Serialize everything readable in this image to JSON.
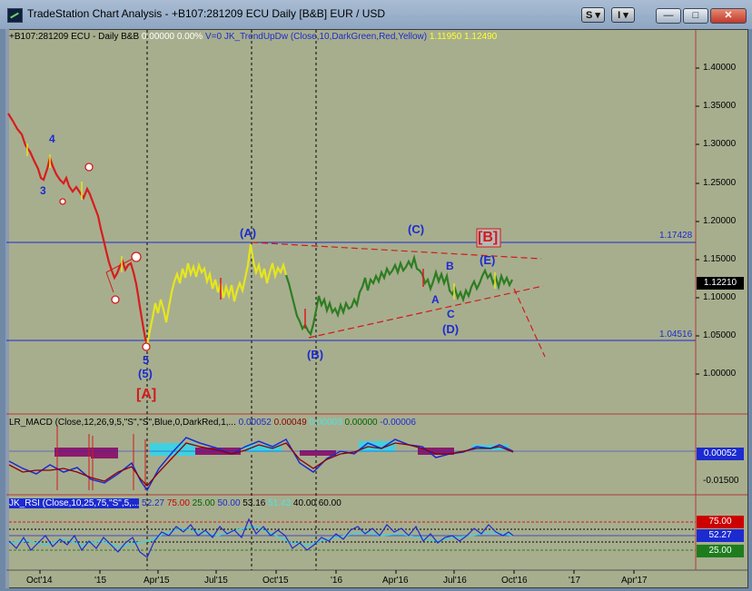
{
  "window": {
    "title": "TradeStation Chart Analysis - +B107:281209 ECU Daily [B&B] EUR / USD",
    "buttons": [
      "S",
      "I"
    ],
    "minimize": "—",
    "maximize": "□",
    "close": "✕"
  },
  "main_pane": {
    "label_parts": [
      {
        "text": "+B107:281209 ECU - Daily  B&B",
        "color": "#000000"
      },
      {
        "text": "  0.00000  0.00%",
        "color": "#ffffff"
      },
      {
        "text": "  V=0  JK_TrendUpDw (Close,10,DarkGreen,Red,Yellow)",
        "color": "#1c2bd0"
      },
      {
        "text": "  1.11950",
        "color": "#ffff33"
      },
      {
        "text": "  1.12490",
        "color": "#ffff33"
      }
    ],
    "price_axis": [
      "1.40000",
      "1.35000",
      "1.30000",
      "1.25000",
      "1.20000",
      "1.15000",
      "1.10000",
      "1.05000",
      "1.00000"
    ],
    "last_price": "1.12210",
    "level_high": "1.17428",
    "level_low": "1.04516",
    "wave_labels": {
      "w4": "4",
      "w3": "3",
      "wA_top": "(A)",
      "wC": "(C)",
      "wB_box": "[B]",
      "wE": "(E)",
      "wB_small": "B",
      "wA_small": "A",
      "wC_small": "C",
      "wD": "(D)",
      "wB_paren": "(B)",
      "w5": "5",
      "w5_paren": "(5)",
      "wA_box": "[A]"
    }
  },
  "macd_pane": {
    "label_parts": [
      {
        "text": "LR_MACD (Close,12,26,9,5,\"S\",\"S\",Blue,0,DarkRed,1,...",
        "color": "#000000"
      },
      {
        "text": "  0.00052",
        "color": "#1c2bd0"
      },
      {
        "text": "  0.00049",
        "color": "#8b0000"
      },
      {
        "text": "  0.00003",
        "color": "#4fe3e3"
      },
      {
        "text": "  0.00000",
        "color": "#006400"
      },
      {
        "text": "  -0.00006",
        "color": "#1c2bd0"
      }
    ],
    "axis": [
      "-0.01500"
    ],
    "last_value": "0.00052"
  },
  "rsi_pane": {
    "label_parts": [
      {
        "text": "JK_RSI (Close,10,25,75,\"S\",5,...",
        "color": "#000000"
      },
      {
        "text": "  52.27",
        "color": "#1c2bd0"
      },
      {
        "text": "  75.00",
        "color": "#cc0000"
      },
      {
        "text": "  25.00",
        "color": "#006400"
      },
      {
        "text": "  50.00",
        "color": "#1c2bd0"
      },
      {
        "text": "  53.16",
        "color": "#000000"
      },
      {
        "text": "  51.43",
        "color": "#4fe3e3"
      },
      {
        "text": "  40.00",
        "color": "#000000"
      },
      {
        "text": "  60.00",
        "color": "#000000"
      }
    ],
    "tags": {
      "upper": "75.00",
      "value": "52.27",
      "lower": "25.00"
    }
  },
  "time_axis": [
    "Oct'14",
    "'15",
    "Apr'15",
    "Jul'15",
    "Oct'15",
    "'16",
    "Apr'16",
    "Jul'16",
    "Oct'16",
    "'17",
    "Apr'17"
  ]
}
